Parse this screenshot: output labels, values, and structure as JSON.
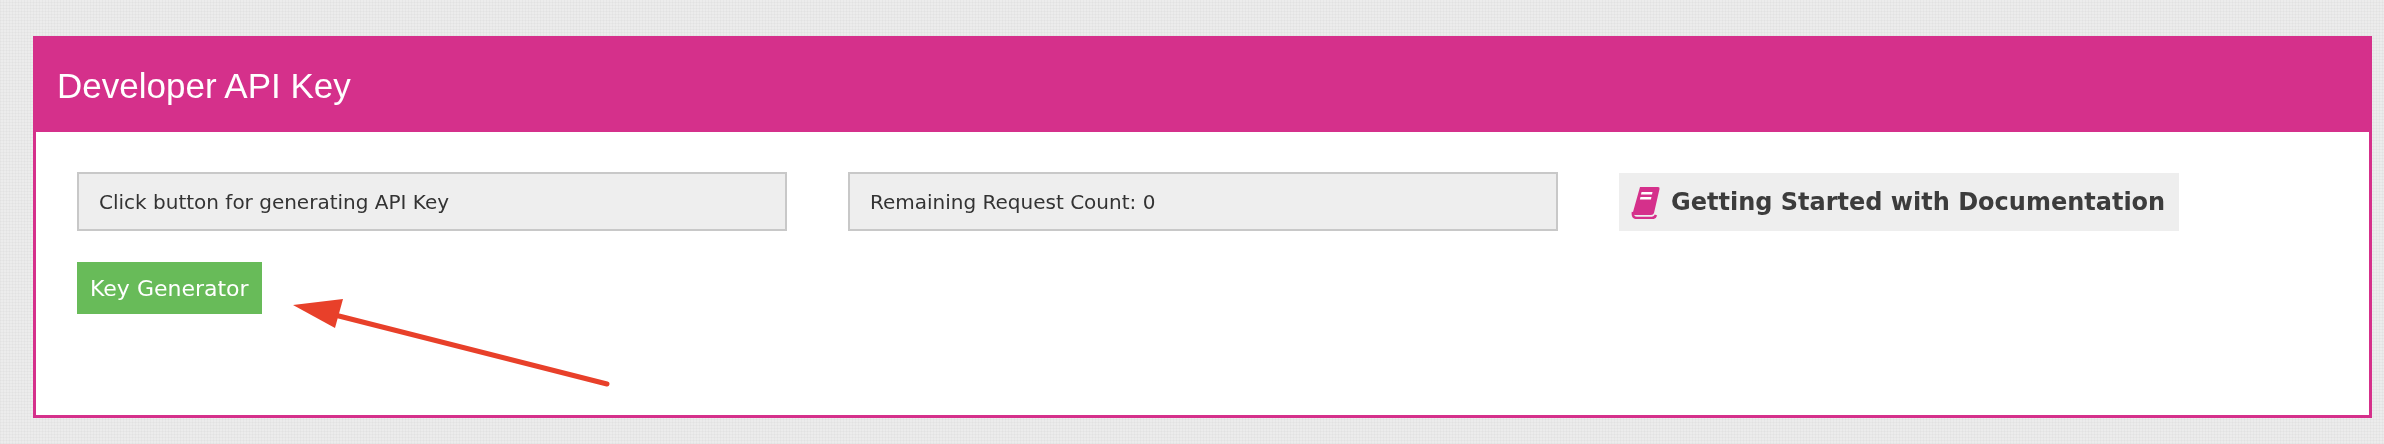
{
  "panel": {
    "title": "Developer API Key"
  },
  "api_key_field": {
    "value": "Click button for generating API Key"
  },
  "request_count_field": {
    "value": "Remaining Request Count: 0"
  },
  "documentation_link": {
    "label": "Getting Started with Documentation"
  },
  "key_generator_button": {
    "label": "Key Generator"
  }
}
